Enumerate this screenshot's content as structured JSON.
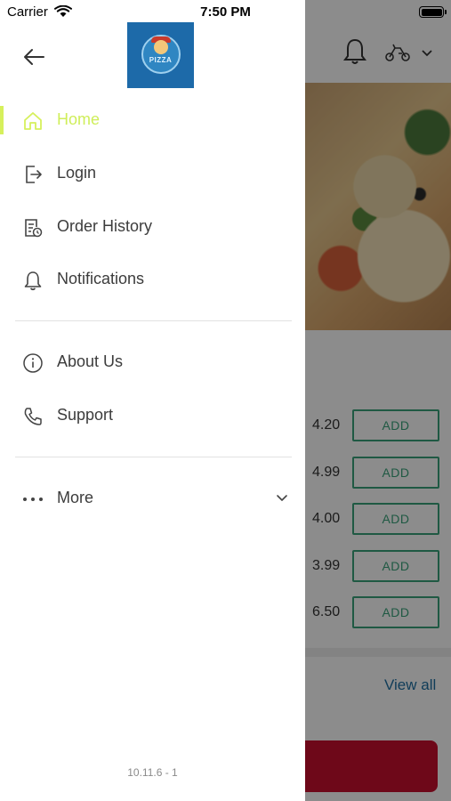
{
  "status_bar": {
    "carrier": "Carrier",
    "time": "7:50 PM"
  },
  "drawer": {
    "menu_primary": [
      {
        "label": "Home",
        "icon": "home-icon",
        "active": true
      },
      {
        "label": "Login",
        "icon": "login-icon",
        "active": false
      },
      {
        "label": "Order History",
        "icon": "order-history-icon",
        "active": false
      },
      {
        "label": "Notifications",
        "icon": "bell-icon",
        "active": false
      }
    ],
    "menu_secondary": [
      {
        "label": "About Us",
        "icon": "info-icon"
      },
      {
        "label": "Support",
        "icon": "phone-icon"
      }
    ],
    "more": {
      "label": "More",
      "icon": "more-dots-icon"
    },
    "version": "10.11.6 - 1",
    "accent_color": "#d6f05c"
  },
  "background": {
    "prices": [
      "4.20",
      "4.99",
      "4.00",
      "3.99",
      "6.50"
    ],
    "add_label": "ADD",
    "view_all": "View all",
    "accent_green": "#3aa37a",
    "link_blue": "#1f6fa3",
    "cta_red": "#c8102e"
  }
}
